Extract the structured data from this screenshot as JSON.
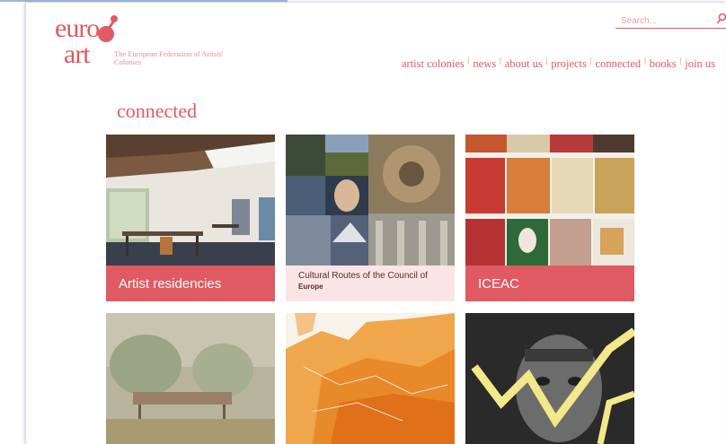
{
  "logo": {
    "line1": "euro",
    "line2": "art",
    "tagline": "The European Federation of Artists' Colonies"
  },
  "search": {
    "placeholder": "Search..."
  },
  "nav": [
    "artist colonies",
    "news",
    "about us",
    "projects",
    "connected",
    "books",
    "join us"
  ],
  "page": {
    "heading": "connected"
  },
  "tiles": [
    {
      "caption": "Artist residencies"
    },
    {
      "caption": "Cultural Routes of the Council of",
      "caption_line2": "Europe"
    },
    {
      "caption": "ICEAC"
    },
    {
      "caption": ""
    },
    {
      "caption": ""
    },
    {
      "caption": ""
    }
  ],
  "colors": {
    "accent": "#e05a63",
    "accent_light": "#fbe4e5"
  }
}
